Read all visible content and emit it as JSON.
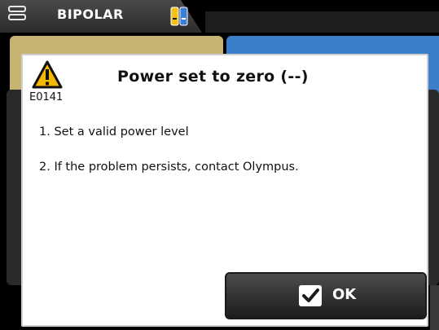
{
  "header": {
    "mode_label": "BIPOLAR",
    "menu_icon": "menu-icon",
    "electrode_icon": "electrode-indicator-icon",
    "colors": {
      "electrode_left": "#f2c318",
      "electrode_right": "#3b7fd6"
    }
  },
  "background": {
    "colors": {
      "yellow_band": "#c8b472",
      "blue_band": "#3a7fc7"
    }
  },
  "dialog": {
    "icon": "warning-icon",
    "error_code": "E0141",
    "title": "Power set to zero (--)",
    "instructions": [
      "1. Set a valid power level",
      "2. If the problem persists, contact Olympus."
    ],
    "ok_button": {
      "label": "OK",
      "icon": "checkmark-icon"
    }
  }
}
